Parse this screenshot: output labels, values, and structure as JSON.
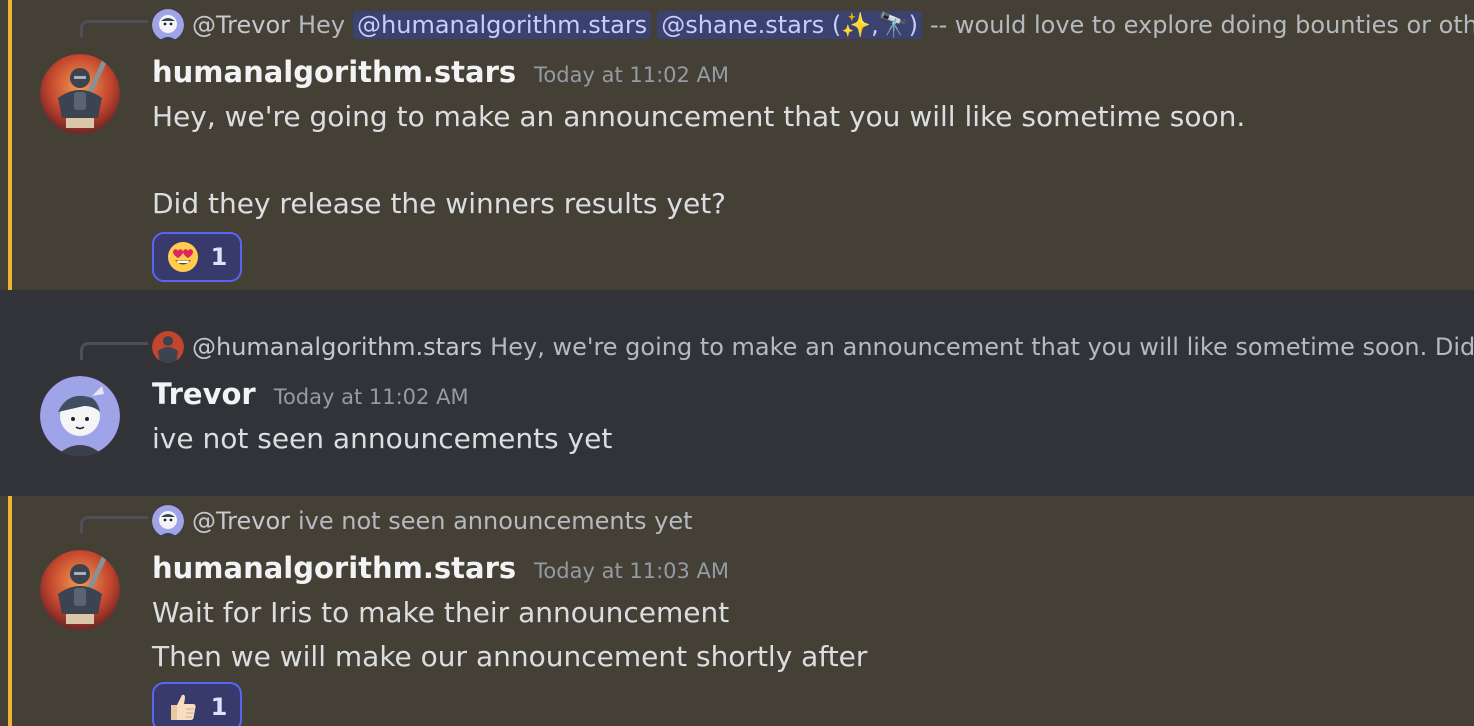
{
  "messages": [
    {
      "reply": {
        "author": "@Trevor",
        "text_before": "Hey",
        "mentions": [
          "@humanalgorithm.stars",
          "@shane.stars (✨,🔭)"
        ],
        "text_after": "-- would love to explore doing bounties or othe"
      },
      "author": "humanalgorithm.stars",
      "timestamp": "Today at 11:02 AM",
      "lines": [
        "Hey, we're going to make an announcement that you will like sometime soon.",
        "",
        "Did they release the winners results yet?"
      ],
      "reaction": {
        "emoji": "heart-eyes",
        "count": "1"
      }
    },
    {
      "reply": {
        "author": "@humanalgorithm.stars",
        "text": "Hey, we're going to make an announcement that you will like sometime soon. Did the"
      },
      "author": "Trevor",
      "timestamp": "Today at 11:02 AM",
      "lines": [
        "ive not seen announcements yet"
      ]
    },
    {
      "reply": {
        "author": "@Trevor",
        "text": "ive not seen announcements yet"
      },
      "author": "humanalgorithm.stars",
      "timestamp": "Today at 11:03 AM",
      "lines": [
        "Wait for Iris to make their announcement",
        "Then we will make our announcement shortly after"
      ],
      "reaction": {
        "emoji": "thumbs-up",
        "count": "1"
      }
    }
  ],
  "colors": {
    "background": "#313338",
    "mention_highlight": "#444036",
    "mention_bar": "#f0b232",
    "reaction_border": "#5865f2",
    "mention_pill": "#3c4270"
  }
}
